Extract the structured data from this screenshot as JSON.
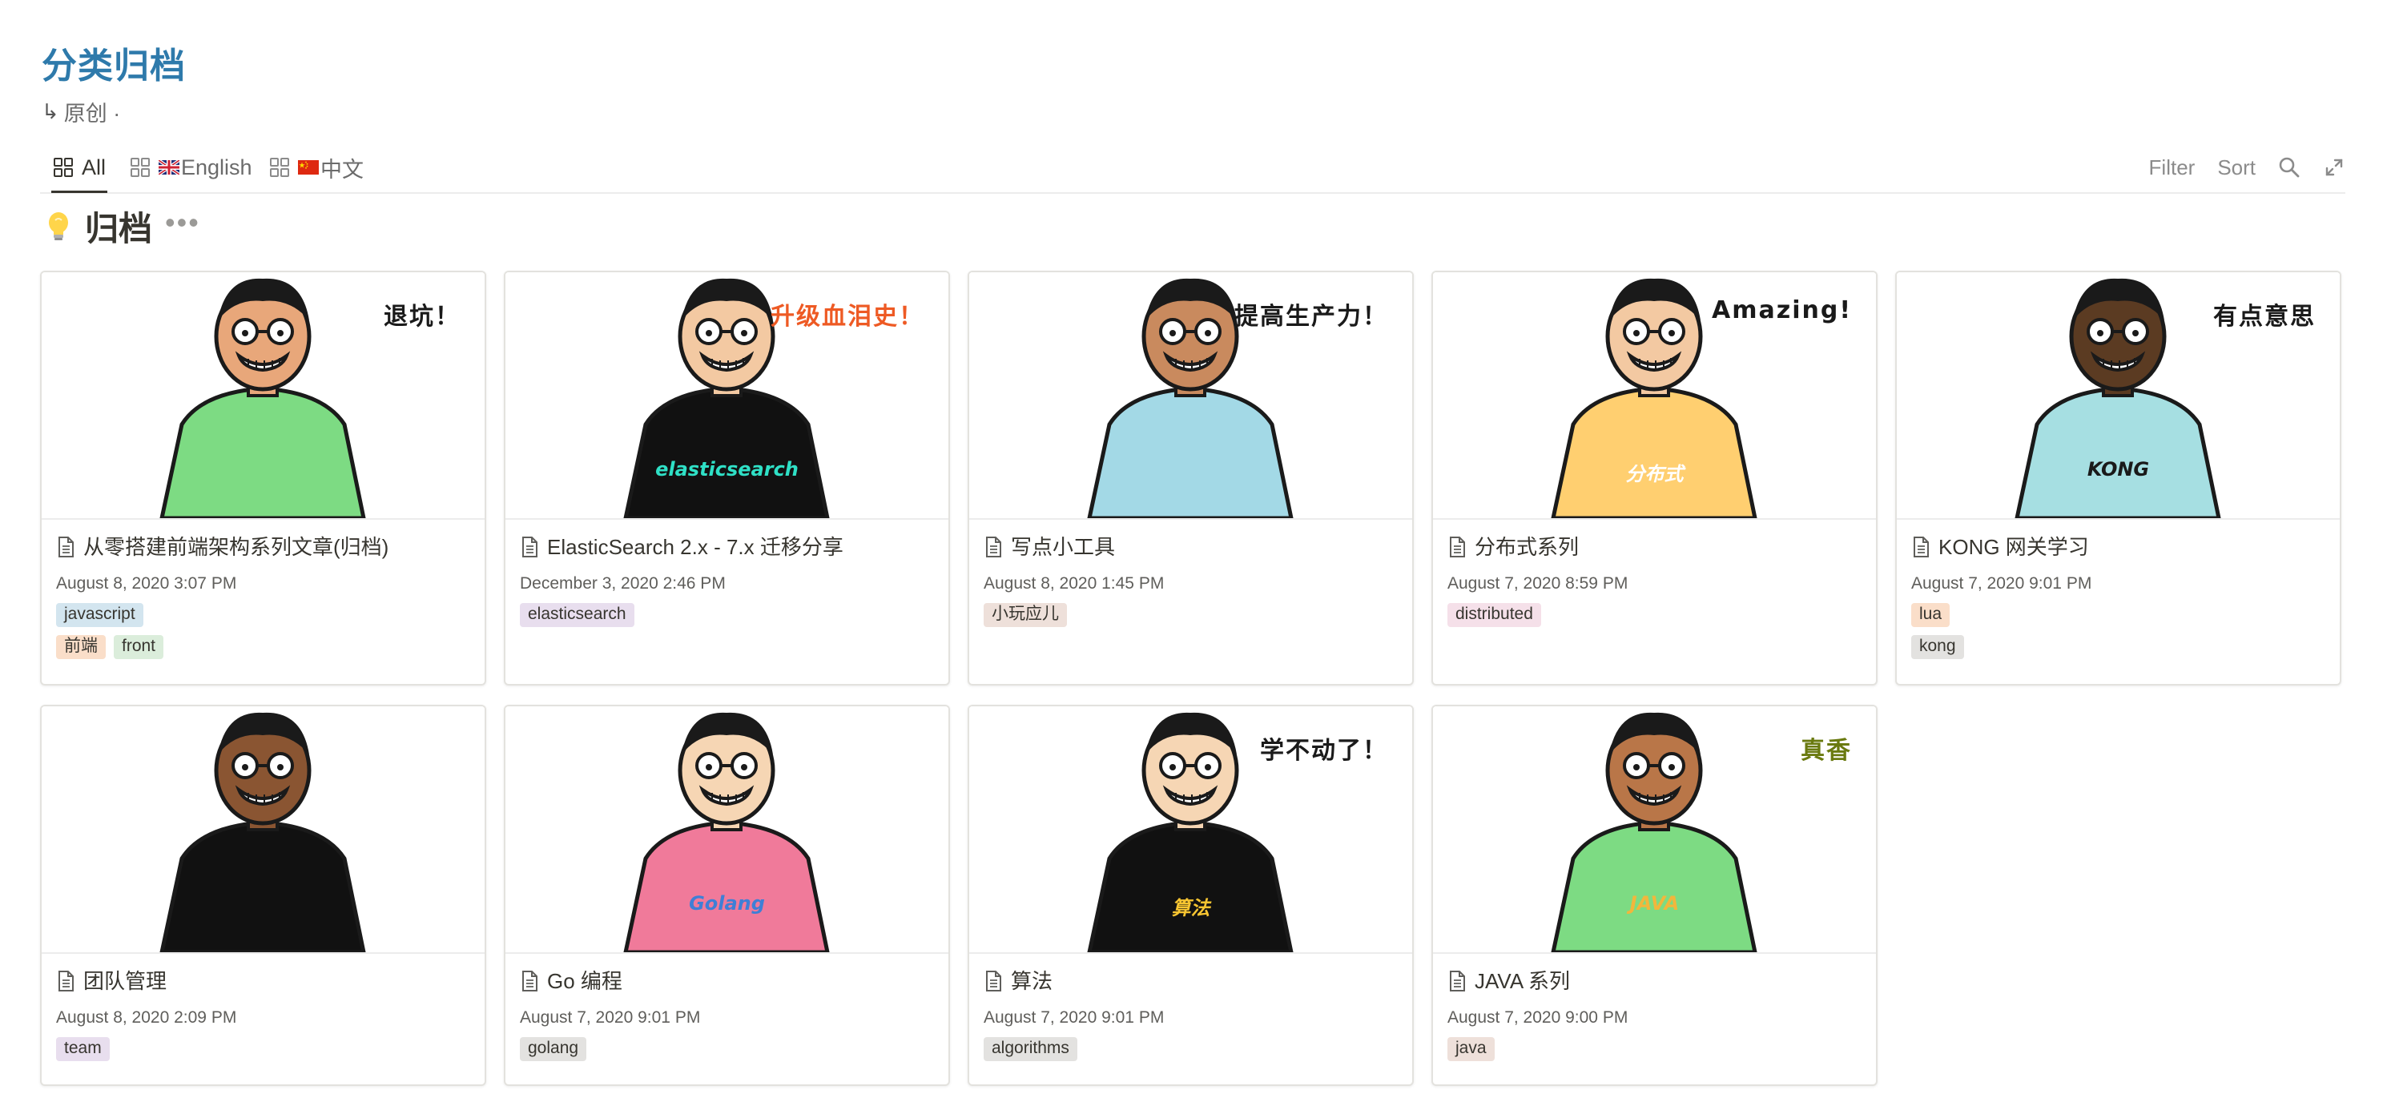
{
  "page": {
    "title": "分类归档",
    "breadcrumb": "原创 ·"
  },
  "tabs": [
    {
      "label": "All",
      "flag": ""
    },
    {
      "label": "English",
      "flag": "uk-flag"
    },
    {
      "label": "中文",
      "flag": "cn-flag"
    }
  ],
  "view_actions": {
    "filter": "Filter",
    "sort": "Sort"
  },
  "database": {
    "title": "归档"
  },
  "cards": [
    {
      "title": "从零搭建前端架构系列文章(归档)",
      "date": "August 8, 2020 3:07 PM",
      "tags": [
        [
          {
            "text": "javascript",
            "color": "#d3e5ef"
          }
        ],
        [
          {
            "text": "前端",
            "color": "#fadec9"
          },
          {
            "text": "front",
            "color": "#dbeddb"
          }
        ]
      ],
      "cover": {
        "caption": "退坑！",
        "caption_color": "#1a1a1a",
        "shirt": "#7ddb83"
      }
    },
    {
      "title": "ElasticSearch 2.x - 7.x 迁移分享",
      "date": "December 3, 2020 2:46 PM",
      "tags": [
        [
          {
            "text": "elasticsearch",
            "color": "#e8deee"
          }
        ]
      ],
      "cover": {
        "caption": "升级血泪史！",
        "caption_color": "#ee5a24",
        "shirt": "#111111",
        "shirt_text": "elasticsearch",
        "shirt_text_color": "#2fe0c6"
      }
    },
    {
      "title": "写点小工具",
      "date": "August 8, 2020 1:45 PM",
      "tags": [
        [
          {
            "text": "小玩应儿",
            "color": "#eee0da"
          }
        ]
      ],
      "cover": {
        "caption": "提高生产力！",
        "caption_color": "#1a1a1a",
        "shirt": "#a3d9e6"
      }
    },
    {
      "title": "分布式系列",
      "date": "August 7, 2020 8:59 PM",
      "tags": [
        [
          {
            "text": "distributed",
            "color": "#f5e0e9"
          }
        ]
      ],
      "cover": {
        "caption": "Amazing!",
        "caption_color": "#1a1a1a",
        "shirt": "#ffcf70",
        "shirt_text": "分布式",
        "shirt_text_color": "#ffffff"
      }
    },
    {
      "title": "KONG 网关学习",
      "date": "August 7, 2020 9:01 PM",
      "tags": [
        [
          {
            "text": "lua",
            "color": "#fadec9"
          }
        ],
        [
          {
            "text": "kong",
            "color": "#e3e2e0"
          }
        ]
      ],
      "cover": {
        "caption": "有点意思",
        "caption_color": "#1a1a1a",
        "shirt": "#a6dfe2",
        "shirt_text": "KONG",
        "shirt_text_color": "#1a1a1a"
      }
    },
    {
      "title": "团队管理",
      "date": "August 8, 2020 2:09 PM",
      "tags": [
        [
          {
            "text": "team",
            "color": "#e8deee"
          }
        ]
      ],
      "cover": {
        "caption": "",
        "caption_color": "#1a1a1a",
        "shirt": "#111111"
      }
    },
    {
      "title": "Go 编程",
      "date": "August 7, 2020 9:01 PM",
      "tags": [
        [
          {
            "text": "golang",
            "color": "#e3e2e0"
          }
        ]
      ],
      "cover": {
        "caption": "",
        "caption_color": "#1a1a1a",
        "shirt": "#f07a9a",
        "shirt_text": "Golang",
        "shirt_text_color": "#3f7fd6"
      }
    },
    {
      "title": "算法",
      "date": "August 7, 2020 9:01 PM",
      "tags": [
        [
          {
            "text": "algorithms",
            "color": "#e3e2e0"
          }
        ]
      ],
      "cover": {
        "caption": "学不动了！",
        "caption_color": "#1a1a1a",
        "shirt": "#111111",
        "shirt_text": "算法",
        "shirt_text_color": "#f7c531"
      }
    },
    {
      "title": "JAVA 系列",
      "date": "August 7, 2020 9:00 PM",
      "tags": [
        [
          {
            "text": "java",
            "color": "#eee0da"
          }
        ]
      ],
      "cover": {
        "caption": "真香",
        "caption_color": "#6a7a10",
        "shirt": "#7ddb83",
        "shirt_text": "JAVA",
        "shirt_text_color": "#f2b63c"
      }
    }
  ]
}
